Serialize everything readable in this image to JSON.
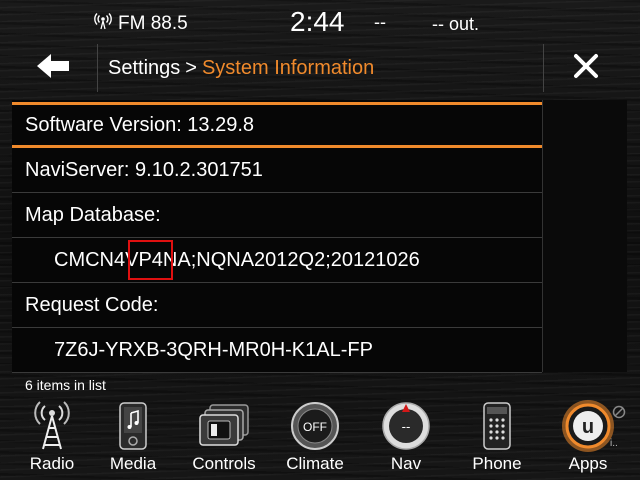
{
  "status": {
    "radio": "FM 88.5",
    "time": "2:44",
    "dash": "--",
    "outside_temp": "-- out."
  },
  "header": {
    "breadcrumb_parent": "Settings",
    "breadcrumb_sep": ">",
    "breadcrumb_current": "System Information"
  },
  "list": {
    "items": [
      {
        "label": "Software Version: 13.29.8"
      },
      {
        "label": "NaviServer: 9.10.2.301751"
      },
      {
        "label": "Map Database:"
      },
      {
        "label": "CMCN4VP4NA;NQNA2012Q2;20121026"
      },
      {
        "label": "Request Code:"
      },
      {
        "label": "7Z6J-YRXB-3QRH-MR0H-K1AL-FP"
      }
    ],
    "count_text": "6 items in list"
  },
  "dock": [
    {
      "label": "Radio",
      "icon": "radio-tower-icon"
    },
    {
      "label": "Media",
      "icon": "music-note-icon"
    },
    {
      "label": "Controls",
      "icon": "controls-icon"
    },
    {
      "label": "Climate",
      "icon": "climate-off-icon",
      "badge": "OFF"
    },
    {
      "label": "Nav",
      "icon": "nav-compass-icon",
      "badge": "--"
    },
    {
      "label": "Phone",
      "icon": "phone-keypad-icon"
    },
    {
      "label": "Apps",
      "icon": "uconnect-apps-icon",
      "badge": "u"
    }
  ],
  "colors": {
    "accent": "#f08a2c",
    "highlight": "#e01010",
    "background": "#141414"
  }
}
